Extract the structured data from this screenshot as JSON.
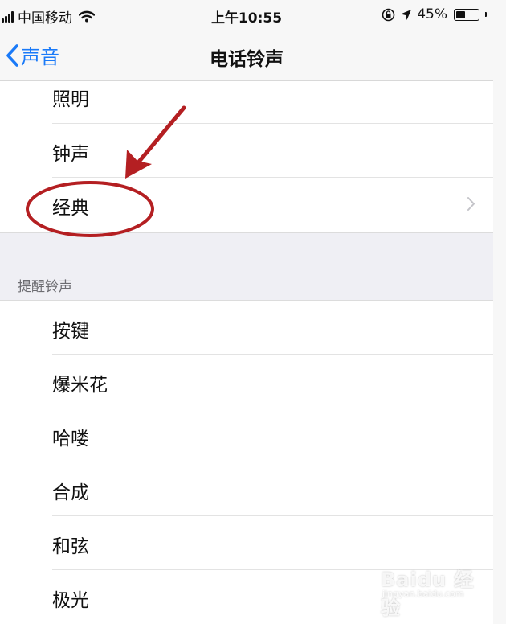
{
  "status_bar": {
    "carrier": "中国移动",
    "time": "上午10:55",
    "battery": "45%",
    "battery_level": 0.45,
    "icons": [
      "signal-icon",
      "wifi-icon",
      "orientation-lock-icon",
      "location-icon",
      "battery-icon"
    ]
  },
  "nav": {
    "back_label": "声音",
    "title": "电话铃声"
  },
  "ringtones": [
    {
      "label": "照明"
    },
    {
      "label": "钟声"
    },
    {
      "label": "经典",
      "has_chevron": true
    }
  ],
  "alert_section": {
    "header": "提醒铃声",
    "items": [
      {
        "label": "按键"
      },
      {
        "label": "爆米花"
      },
      {
        "label": "哈喽"
      },
      {
        "label": "合成"
      },
      {
        "label": "和弦"
      },
      {
        "label": "极光"
      }
    ]
  },
  "watermark": {
    "brand": "Baidu 经验",
    "url": "jingyan.baidu.com"
  },
  "colors": {
    "accent": "#1a7af8",
    "annotation": "#b41f22",
    "section_bg": "#efeff4"
  }
}
